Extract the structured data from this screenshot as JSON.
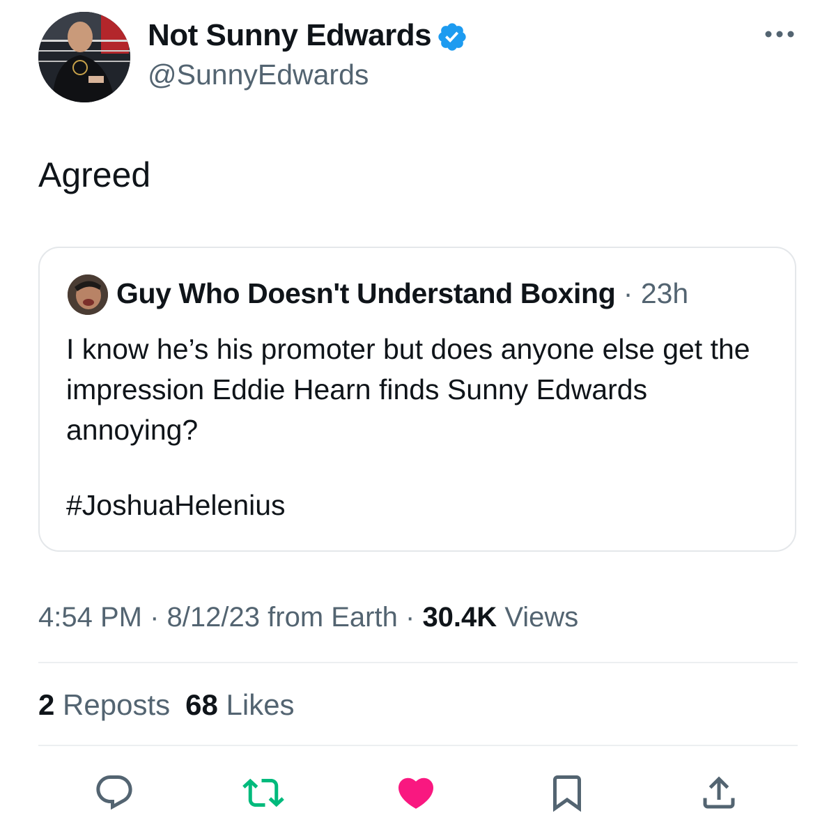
{
  "author": {
    "display_name": "Not Sunny Edwards",
    "handle": "@SunnyEdwards",
    "verified_icon": "verified-badge-icon"
  },
  "tweet": {
    "text": "Agreed"
  },
  "quoted": {
    "author_name": "Guy Who Doesn't Understand Boxing",
    "separator": "·",
    "time": "23h",
    "body": "I know he’s his promoter but does anyone else get the impression Eddie Hearn finds Sunny Edwards annoying?",
    "hashtag": "#JoshuaHelenius"
  },
  "meta": {
    "time": "4:54 PM",
    "sep1": "·",
    "date": "8/12/23",
    "source": "from Earth",
    "sep2": "·",
    "views_count": "30.4K",
    "views_label": "Views"
  },
  "stats": {
    "reposts_count": "2",
    "reposts_label": "Reposts",
    "likes_count": "68",
    "likes_label": "Likes"
  },
  "actions": [
    {
      "icon": "reply-icon"
    },
    {
      "icon": "repost-icon"
    },
    {
      "icon": "like-icon"
    },
    {
      "icon": "bookmark-icon"
    },
    {
      "icon": "share-icon"
    }
  ],
  "colors": {
    "verified": "#1d9bf0",
    "repost_green": "#00ba7c",
    "like_pink": "#f91880",
    "secondary_text": "#536471",
    "primary_text": "#0f1419"
  }
}
